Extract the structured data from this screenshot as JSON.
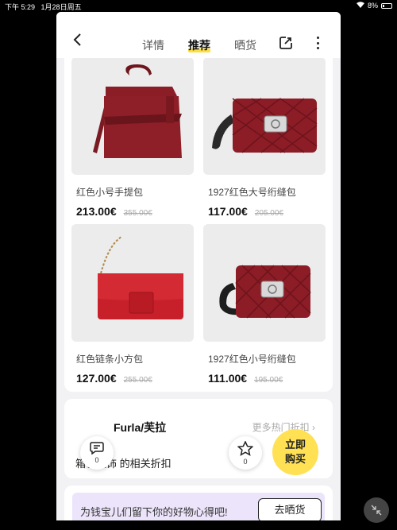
{
  "status_bar": {
    "time": "下午 5:29",
    "date": "1月28日周五",
    "battery": "8%"
  },
  "nav": {
    "tabs": [
      {
        "label": "详情"
      },
      {
        "label": "推荐"
      },
      {
        "label": "晒货"
      }
    ]
  },
  "products": [
    {
      "name": "红色小号手提包",
      "price": "213.00€",
      "old_price": "355.00€"
    },
    {
      "name": "1927红色大号绗缝包",
      "price": "117.00€",
      "old_price": "205.00€"
    },
    {
      "name": "红色链条小方包",
      "price": "127.00€",
      "old_price": "255.00€"
    },
    {
      "name": "1927红色小号绗缝包",
      "price": "111.00€",
      "old_price": "195.00€"
    }
  ],
  "brand": {
    "name": "Furla/芙拉",
    "more": "更多热门折扣",
    "subtitle": "箱包服饰 的相关折扣"
  },
  "floating": {
    "comment_count": "0",
    "favorite_count": "0",
    "buy_line1": "立即",
    "buy_line2": "购买"
  },
  "banner": {
    "text": "为钱宝儿们留下你的好物心得吧!",
    "button": "去晒货"
  },
  "colors": {
    "accent": "#ffe153",
    "bag_red": "#8e1f28",
    "bright_red": "#c8202a"
  }
}
